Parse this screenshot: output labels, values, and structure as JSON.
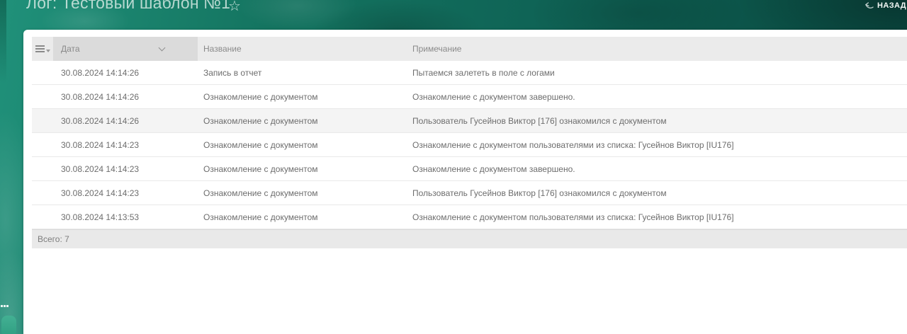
{
  "header": {
    "title": "Лог: Тестовый шаблон №1",
    "back_label": "НАЗАД"
  },
  "table": {
    "columns": [
      {
        "label": "Дата",
        "sorted": true
      },
      {
        "label": "Название",
        "sorted": false
      },
      {
        "label": "Примечание",
        "sorted": false
      }
    ],
    "rows": [
      {
        "date": "30.08.2024 14:14:26",
        "name": "Запись в отчет",
        "note": "Пытаемся залететь в поле с логами",
        "highlighted": false
      },
      {
        "date": "30.08.2024 14:14:26",
        "name": "Ознакомление с документом",
        "note": "Ознакомление с документом завершено.",
        "highlighted": false
      },
      {
        "date": "30.08.2024 14:14:26",
        "name": "Ознакомление с документом",
        "note": "Пользователь Гусейнов Виктор [176] ознакомился с документом",
        "highlighted": true
      },
      {
        "date": "30.08.2024 14:14:23",
        "name": "Ознакомление с документом",
        "note": "Ознакомление с документом пользователями из списка: Гусейнов Виктор [IU176]",
        "highlighted": false
      },
      {
        "date": "30.08.2024 14:14:23",
        "name": "Ознакомление с документом",
        "note": "Ознакомление с документом завершено.",
        "highlighted": false
      },
      {
        "date": "30.08.2024 14:14:23",
        "name": "Ознакомление с документом",
        "note": "Пользователь Гусейнов Виктор [176] ознакомился с документом",
        "highlighted": false
      },
      {
        "date": "30.08.2024 14:13:53",
        "name": "Ознакомление с документом",
        "note": "Ознакомление с документом пользователями из списка: Гусейнов Виктор [IU176]",
        "highlighted": false
      }
    ],
    "total_label": "Всего: 7"
  },
  "icons": {
    "favorite": "star-outline",
    "back": "curved-back-arrow",
    "columns_menu": "hamburger-with-caret",
    "date_sort": "chevron-down"
  },
  "colors": {
    "background_teal_dark": "#0a4b43",
    "background_teal_light": "#2aa186",
    "panel_bg": "#ffffff",
    "header_cell_bg": "#ebebeb",
    "sorted_column_header_bg": "#dbdbdb",
    "highlighted_row_bg": "#f4f4f4",
    "footer_bg": "#e9e9e9",
    "title_text": "#dceee9",
    "header_text": "#8a8a8a",
    "row_text": "#6d6d6d"
  }
}
